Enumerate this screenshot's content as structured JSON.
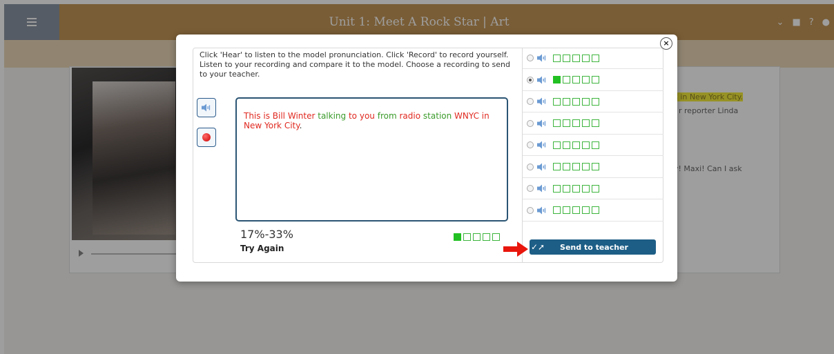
{
  "header": {
    "title": "Unit 1: Meet A Rock Star | Art",
    "help": "?"
  },
  "background": {
    "text_line1_highlight": "YC in New York City.",
    "text_line2": "r reporter Linda",
    "text_line3": "ky! Maxi! Can I ask"
  },
  "modal": {
    "instructions": "Click 'Hear' to listen to the model pronunciation. Click 'Record' to record yourself. Listen to your recording and compare it to the model. Choose a recording to send to your teacher.",
    "sentence_words": [
      {
        "text": "This",
        "status": "wrong"
      },
      {
        "text": "is",
        "status": "wrong"
      },
      {
        "text": "Bill",
        "status": "wrong"
      },
      {
        "text": "Winter",
        "status": "wrong"
      },
      {
        "text": "talking",
        "status": "correct"
      },
      {
        "text": "to",
        "status": "wrong"
      },
      {
        "text": "you",
        "status": "wrong"
      },
      {
        "text": "from",
        "status": "correct"
      },
      {
        "text": "radio",
        "status": "wrong"
      },
      {
        "text": "station",
        "status": "correct"
      },
      {
        "text": "WNYC",
        "status": "wrong"
      },
      {
        "text": "in",
        "status": "wrong"
      },
      {
        "text": "New",
        "status": "wrong"
      },
      {
        "text": "York",
        "status": "wrong"
      },
      {
        "text": "City",
        "status": "wrong"
      }
    ],
    "sentence_end": ".",
    "score_range": "17%-33%",
    "feedback": "Try Again",
    "score_level": 1,
    "score_max": 5,
    "send_label": "Send to teacher",
    "recordings": [
      {
        "selected": false,
        "level": 0
      },
      {
        "selected": true,
        "level": 1
      },
      {
        "selected": false,
        "level": 0
      },
      {
        "selected": false,
        "level": 0
      },
      {
        "selected": false,
        "level": 0
      },
      {
        "selected": false,
        "level": 0
      },
      {
        "selected": false,
        "level": 0
      },
      {
        "selected": false,
        "level": 0
      }
    ]
  },
  "colors": {
    "correct": "#3a9b2a",
    "wrong": "#e0281f",
    "accent": "#1d5e86",
    "header": "#c49757"
  },
  "icons": {
    "hear": "speaker-icon",
    "record": "record-icon",
    "close": "close-icon",
    "send": "send-check-icon",
    "menu": "hamburger-icon"
  }
}
